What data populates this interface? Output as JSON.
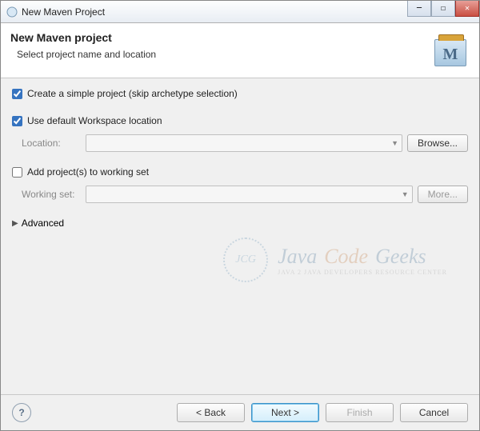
{
  "window": {
    "title": "New Maven Project"
  },
  "banner": {
    "title": "New Maven project",
    "subtitle": "Select project name and location",
    "iconLetter": "M"
  },
  "form": {
    "simpleProjectLabel": "Create a simple project (skip archetype selection)",
    "simpleProjectChecked": true,
    "useDefaultLabel": "Use default Workspace location",
    "useDefaultChecked": true,
    "locationLabel": "Location:",
    "locationValue": "",
    "browseLabel": "Browse...",
    "addWorkingSetLabel": "Add project(s) to working set",
    "addWorkingSetChecked": false,
    "workingSetLabel": "Working set:",
    "workingSetValue": "",
    "moreLabel": "More...",
    "advancedLabel": "Advanced"
  },
  "footer": {
    "helpGlyph": "?",
    "back": "< Back",
    "next": "Next >",
    "finish": "Finish",
    "cancel": "Cancel"
  },
  "watermark": {
    "circle": "JCG",
    "t1": "Java",
    "t2": "Code",
    "t3": "Geeks",
    "sub": "JAVA 2 JAVA DEVELOPERS RESOURCE CENTER"
  }
}
